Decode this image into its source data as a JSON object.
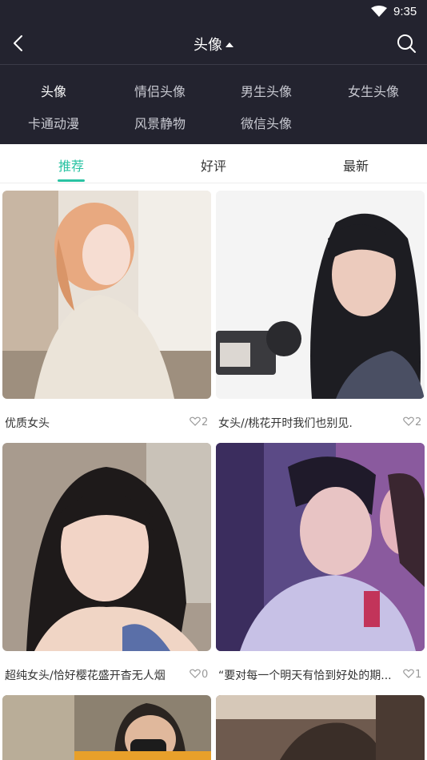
{
  "status": {
    "time": "9:35"
  },
  "header": {
    "title": "头像"
  },
  "categories": {
    "row1": [
      "头像",
      "情侣头像",
      "男生头像",
      "女生头像"
    ],
    "row2": [
      "卡通动漫",
      "风景静物",
      "微信头像"
    ]
  },
  "tabs": [
    "推荐",
    "好评",
    "最新"
  ],
  "cards": [
    {
      "caption": "优质女头",
      "likes": "2"
    },
    {
      "caption": "女头//桃花开时我们也别见.",
      "likes": "2"
    },
    {
      "caption": "超纯女头/恰好樱花盛开杳无人烟",
      "likes": "0"
    },
    {
      "caption": "“要对每一个明天有恰到好处的期...",
      "likes": "1"
    }
  ],
  "colors": {
    "header_bg": "#23232f",
    "accent": "#2ac3a3"
  }
}
